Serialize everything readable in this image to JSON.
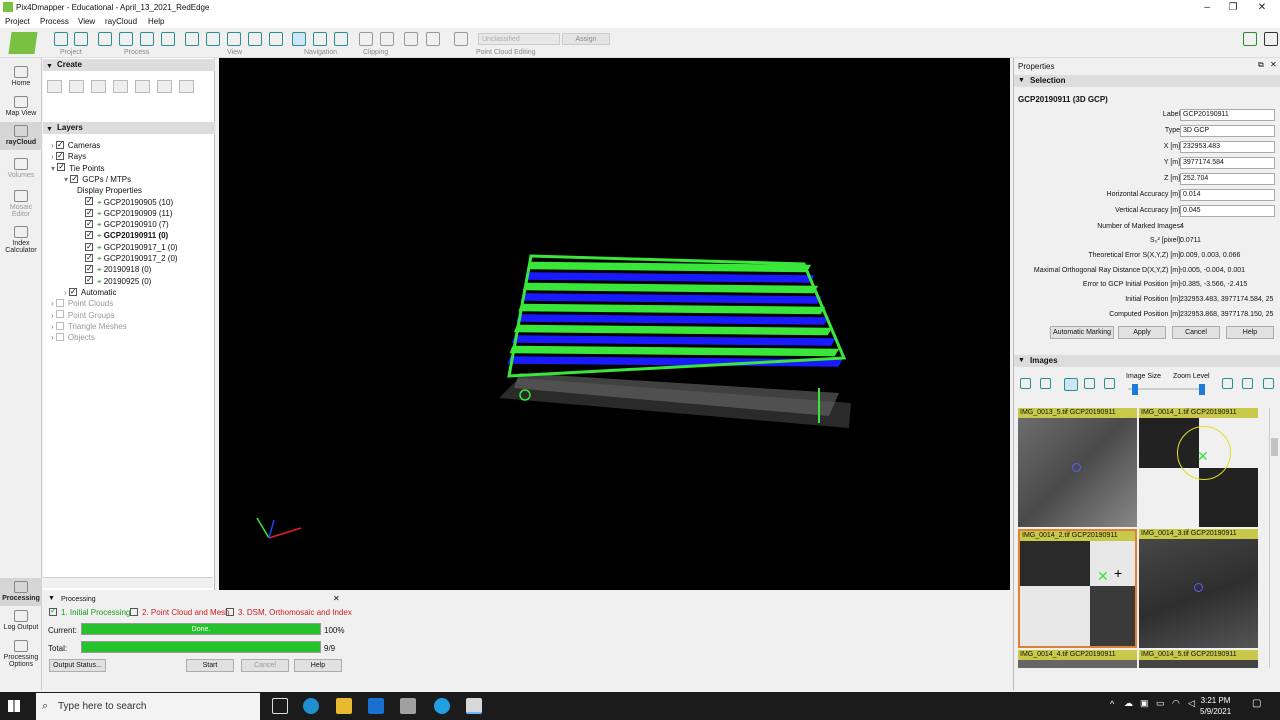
{
  "window": {
    "title": "Pix4Dmapper - Educational - April_13_2021_RedEdge"
  },
  "menu": [
    "Project",
    "Process",
    "View",
    "rayCloud",
    "Help"
  ],
  "toolbar": {
    "groups": [
      "Project",
      "Process",
      "View",
      "Navigation",
      "Clipping",
      "Point Cloud Editing"
    ],
    "class_select": "Unclassified",
    "assign_label": "Assign"
  },
  "leftnav": [
    {
      "label": "Home",
      "icon": "home-icon"
    },
    {
      "label": "Map View",
      "icon": "map-icon"
    },
    {
      "label": "rayCloud",
      "icon": "raycloud-icon",
      "active": true
    },
    {
      "label": "Volumes",
      "icon": "volumes-icon",
      "dim": true
    },
    {
      "label": "Mosaic Editor",
      "icon": "mosaic-icon",
      "dim": true
    },
    {
      "label": "Index Calculator",
      "icon": "index-icon"
    },
    {
      "label": "Processing",
      "icon": "processing-icon",
      "active": true
    },
    {
      "label": "Log Output",
      "icon": "log-icon"
    },
    {
      "label": "Processing Options",
      "icon": "gear-icon"
    }
  ],
  "create": {
    "title": "Create"
  },
  "layers": {
    "title": "Layers",
    "items": [
      {
        "label": "Cameras",
        "checked": true,
        "level": 0
      },
      {
        "label": "Rays",
        "checked": true,
        "level": 0
      },
      {
        "label": "Tie Points",
        "checked": true,
        "level": 0
      },
      {
        "label": "GCPs / MTPs",
        "checked": true,
        "level": 1
      },
      {
        "label": "Display Properties",
        "checked": false,
        "level": 2,
        "nocheck": true
      },
      {
        "label": "GCP20190905 (10)",
        "checked": true,
        "level": 2
      },
      {
        "label": "GCP20190909 (11)",
        "checked": true,
        "level": 2
      },
      {
        "label": "GCP20190910 (7)",
        "checked": true,
        "level": 2
      },
      {
        "label": "GCP20190911 (0)",
        "checked": true,
        "level": 2,
        "selected": true
      },
      {
        "label": "GCP20190917_1 (0)",
        "checked": true,
        "level": 2
      },
      {
        "label": "GCP20190917_2 (0)",
        "checked": true,
        "level": 2
      },
      {
        "label": "20190918 (0)",
        "checked": true,
        "level": 2
      },
      {
        "label": "20190925 (0)",
        "checked": true,
        "level": 2
      },
      {
        "label": "Automatic",
        "checked": true,
        "level": 1
      },
      {
        "label": "Point Clouds",
        "checked": false,
        "level": 0,
        "dim": true
      },
      {
        "label": "Point Groups",
        "checked": false,
        "level": 0,
        "dim": true
      },
      {
        "label": "Triangle Meshes",
        "checked": false,
        "level": 0,
        "dim": true
      },
      {
        "label": "Objects",
        "checked": false,
        "level": 0,
        "dim": true
      }
    ]
  },
  "processing": {
    "title": "Processing",
    "steps": [
      "1. Initial Processing",
      "2. Point Cloud and Mesh",
      "3. DSM, Orthomosaic and Index"
    ],
    "current_label": "Current:",
    "current_text": "Done.",
    "current_pct": "100%",
    "total_label": "Total:",
    "total_value": "9/9",
    "buttons": {
      "output": "Output Status...",
      "start": "Start",
      "cancel": "Cancel",
      "help": "Help"
    }
  },
  "properties": {
    "title": "Properties",
    "section": "Selection",
    "heading": "GCP20190911 (3D GCP)",
    "fields": [
      {
        "label": "Label:",
        "value": "GCP20190911",
        "input": true
      },
      {
        "label": "Type:",
        "value": "3D GCP",
        "input": true
      },
      {
        "label": "X [m]:",
        "value": "232953.483",
        "input": true
      },
      {
        "label": "Y [m]:",
        "value": "3977174.584",
        "input": true
      },
      {
        "label": "Z [m]:",
        "value": "252.704",
        "input": true
      },
      {
        "label": "Horizontal Accuracy [m]:",
        "value": "0.014",
        "input": true
      },
      {
        "label": "Vertical Accuracy [m]:",
        "value": "0.045",
        "input": true
      },
      {
        "label": "Number of Marked Images:",
        "value": "4",
        "input": false
      },
      {
        "label": "S₀² [pixel]:",
        "value": "0.0711",
        "input": false
      },
      {
        "label": "Theoretical Error S(X,Y,Z) [m]:",
        "value": "0.009, 0.003, 0.066",
        "input": false
      },
      {
        "label": "Maximal Orthogonal Ray Distance D(X,Y,Z) [m]:",
        "value": "-0.005, -0.004, 0.001",
        "input": false
      },
      {
        "label": "Error to GCP Initial Position [m]:",
        "value": "-0.385, -3.566, -2.415",
        "input": false
      },
      {
        "label": "Initial Position [m]:",
        "value": "232953.483, 3977174.584, 25",
        "input": false
      },
      {
        "label": "Computed Position [m]:",
        "value": "232953.868, 3977178.150, 25",
        "input": false
      }
    ],
    "buttons": {
      "auto": "Automatic Marking",
      "apply": "Apply",
      "cancel": "Cancel",
      "help": "Help"
    }
  },
  "images": {
    "title": "Images",
    "image_size_label": "Image Size",
    "zoom_label": "Zoom Level",
    "thumbs": [
      {
        "caption": "IMG_0013_5.tif GCP20190911"
      },
      {
        "caption": "IMG_0014_1.tif GCP20190911"
      },
      {
        "caption": "IMG_0014_2.tif GCP20190911"
      },
      {
        "caption": "IMG_0014_3.tif GCP20190911"
      },
      {
        "caption": "IMG_0014_4.tif GCP20190911"
      },
      {
        "caption": "IMG_0014_5.tif GCP20190911"
      }
    ]
  },
  "taskbar": {
    "search_placeholder": "Type here to search",
    "time": "3:21 PM",
    "date": "5/9/2021"
  },
  "colors": {
    "accent_green": "#25c22c",
    "point_green": "#39e639",
    "point_blue": "#1a1aff",
    "caption": "#c8c84a"
  }
}
